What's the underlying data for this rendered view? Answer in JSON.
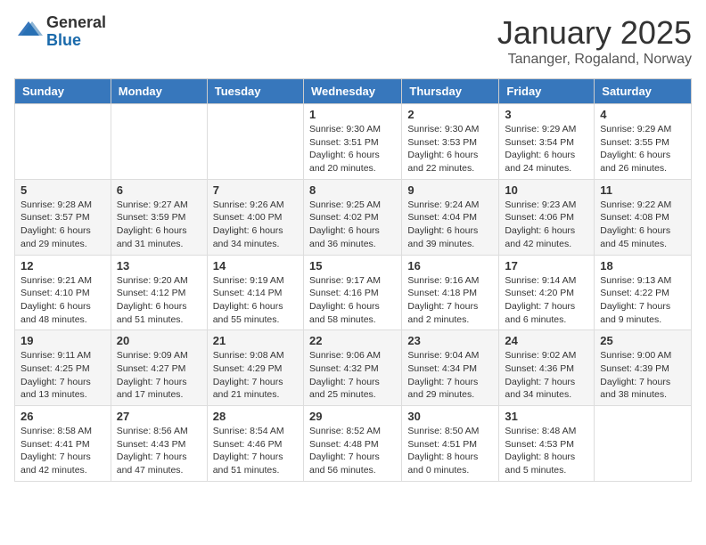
{
  "logo": {
    "general": "General",
    "blue": "Blue"
  },
  "header": {
    "month": "January 2025",
    "location": "Tananger, Rogaland, Norway"
  },
  "weekdays": [
    "Sunday",
    "Monday",
    "Tuesday",
    "Wednesday",
    "Thursday",
    "Friday",
    "Saturday"
  ],
  "weeks": [
    [
      {
        "day": "",
        "info": ""
      },
      {
        "day": "",
        "info": ""
      },
      {
        "day": "",
        "info": ""
      },
      {
        "day": "1",
        "info": "Sunrise: 9:30 AM\nSunset: 3:51 PM\nDaylight: 6 hours\nand 20 minutes."
      },
      {
        "day": "2",
        "info": "Sunrise: 9:30 AM\nSunset: 3:53 PM\nDaylight: 6 hours\nand 22 minutes."
      },
      {
        "day": "3",
        "info": "Sunrise: 9:29 AM\nSunset: 3:54 PM\nDaylight: 6 hours\nand 24 minutes."
      },
      {
        "day": "4",
        "info": "Sunrise: 9:29 AM\nSunset: 3:55 PM\nDaylight: 6 hours\nand 26 minutes."
      }
    ],
    [
      {
        "day": "5",
        "info": "Sunrise: 9:28 AM\nSunset: 3:57 PM\nDaylight: 6 hours\nand 29 minutes."
      },
      {
        "day": "6",
        "info": "Sunrise: 9:27 AM\nSunset: 3:59 PM\nDaylight: 6 hours\nand 31 minutes."
      },
      {
        "day": "7",
        "info": "Sunrise: 9:26 AM\nSunset: 4:00 PM\nDaylight: 6 hours\nand 34 minutes."
      },
      {
        "day": "8",
        "info": "Sunrise: 9:25 AM\nSunset: 4:02 PM\nDaylight: 6 hours\nand 36 minutes."
      },
      {
        "day": "9",
        "info": "Sunrise: 9:24 AM\nSunset: 4:04 PM\nDaylight: 6 hours\nand 39 minutes."
      },
      {
        "day": "10",
        "info": "Sunrise: 9:23 AM\nSunset: 4:06 PM\nDaylight: 6 hours\nand 42 minutes."
      },
      {
        "day": "11",
        "info": "Sunrise: 9:22 AM\nSunset: 4:08 PM\nDaylight: 6 hours\nand 45 minutes."
      }
    ],
    [
      {
        "day": "12",
        "info": "Sunrise: 9:21 AM\nSunset: 4:10 PM\nDaylight: 6 hours\nand 48 minutes."
      },
      {
        "day": "13",
        "info": "Sunrise: 9:20 AM\nSunset: 4:12 PM\nDaylight: 6 hours\nand 51 minutes."
      },
      {
        "day": "14",
        "info": "Sunrise: 9:19 AM\nSunset: 4:14 PM\nDaylight: 6 hours\nand 55 minutes."
      },
      {
        "day": "15",
        "info": "Sunrise: 9:17 AM\nSunset: 4:16 PM\nDaylight: 6 hours\nand 58 minutes."
      },
      {
        "day": "16",
        "info": "Sunrise: 9:16 AM\nSunset: 4:18 PM\nDaylight: 7 hours\nand 2 minutes."
      },
      {
        "day": "17",
        "info": "Sunrise: 9:14 AM\nSunset: 4:20 PM\nDaylight: 7 hours\nand 6 minutes."
      },
      {
        "day": "18",
        "info": "Sunrise: 9:13 AM\nSunset: 4:22 PM\nDaylight: 7 hours\nand 9 minutes."
      }
    ],
    [
      {
        "day": "19",
        "info": "Sunrise: 9:11 AM\nSunset: 4:25 PM\nDaylight: 7 hours\nand 13 minutes."
      },
      {
        "day": "20",
        "info": "Sunrise: 9:09 AM\nSunset: 4:27 PM\nDaylight: 7 hours\nand 17 minutes."
      },
      {
        "day": "21",
        "info": "Sunrise: 9:08 AM\nSunset: 4:29 PM\nDaylight: 7 hours\nand 21 minutes."
      },
      {
        "day": "22",
        "info": "Sunrise: 9:06 AM\nSunset: 4:32 PM\nDaylight: 7 hours\nand 25 minutes."
      },
      {
        "day": "23",
        "info": "Sunrise: 9:04 AM\nSunset: 4:34 PM\nDaylight: 7 hours\nand 29 minutes."
      },
      {
        "day": "24",
        "info": "Sunrise: 9:02 AM\nSunset: 4:36 PM\nDaylight: 7 hours\nand 34 minutes."
      },
      {
        "day": "25",
        "info": "Sunrise: 9:00 AM\nSunset: 4:39 PM\nDaylight: 7 hours\nand 38 minutes."
      }
    ],
    [
      {
        "day": "26",
        "info": "Sunrise: 8:58 AM\nSunset: 4:41 PM\nDaylight: 7 hours\nand 42 minutes."
      },
      {
        "day": "27",
        "info": "Sunrise: 8:56 AM\nSunset: 4:43 PM\nDaylight: 7 hours\nand 47 minutes."
      },
      {
        "day": "28",
        "info": "Sunrise: 8:54 AM\nSunset: 4:46 PM\nDaylight: 7 hours\nand 51 minutes."
      },
      {
        "day": "29",
        "info": "Sunrise: 8:52 AM\nSunset: 4:48 PM\nDaylight: 7 hours\nand 56 minutes."
      },
      {
        "day": "30",
        "info": "Sunrise: 8:50 AM\nSunset: 4:51 PM\nDaylight: 8 hours\nand 0 minutes."
      },
      {
        "day": "31",
        "info": "Sunrise: 8:48 AM\nSunset: 4:53 PM\nDaylight: 8 hours\nand 5 minutes."
      },
      {
        "day": "",
        "info": ""
      }
    ]
  ]
}
